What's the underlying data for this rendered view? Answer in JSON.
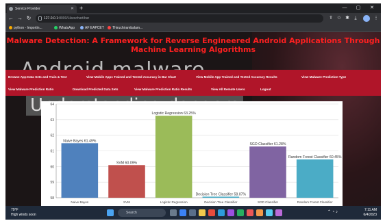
{
  "browser": {
    "tab_title": "Service Provider",
    "url_host": "127.0.0.1",
    "url_path": ":8000/Likeschart/bar",
    "bookmarks": [
      "python - Importin...",
      "WhatsApp",
      "AF EAPCET",
      "Thiruchirambalam..."
    ]
  },
  "page": {
    "title": "Malware Detection: A Framework for Reverse Engineered Android Applications Through Machine Learning Algorithms",
    "background_text_1": "Android malware",
    "background_text_2": "Understanding dangers",
    "menu": [
      "Browse App Data Sets and Train & Test",
      "View Mobile Apps Trained and Tested Accuracy in Bar Chart",
      "View Mobile App Trained and Tested Accuracy Results",
      "View Malware Prediction Type",
      "View Malware Prediction Ratio",
      "Download Predicted Data Sets",
      "View Malware Prediction Ratio Results",
      "View All Remote Users",
      "Logout"
    ]
  },
  "chart_data": {
    "type": "bar",
    "categories": [
      "Naive Bayes",
      "SVM",
      "Logistic Regression",
      "Decision Tree Classifier",
      "SGD Classifier",
      "Random Forest Classifier"
    ],
    "values": [
      61.49,
      60.09,
      63.25,
      58.07,
      61.28,
      60.45
    ],
    "data_labels": [
      "Naive Bayes 61.49%",
      "SVM 60.09%",
      "Logistic Regression 63.25%",
      "Decision Tree Classifier 58.07%",
      "SGD Classifier 61.28%",
      "Random Forest Classifier 60.45%"
    ],
    "colors": [
      "#4f81bd",
      "#c0504d",
      "#9bbb59",
      "#4bacc6",
      "#8064a2",
      "#4bacc6"
    ],
    "ylim": [
      58,
      64
    ],
    "yticks": [
      "58",
      "59",
      "60",
      "61",
      "62",
      "63",
      "64"
    ],
    "grid": true
  },
  "taskbar": {
    "weather_temp": "79°F",
    "weather_desc": "High winds soon",
    "search_placeholder": "Search",
    "time": "7:11 AM",
    "date": "6/4/2023"
  }
}
